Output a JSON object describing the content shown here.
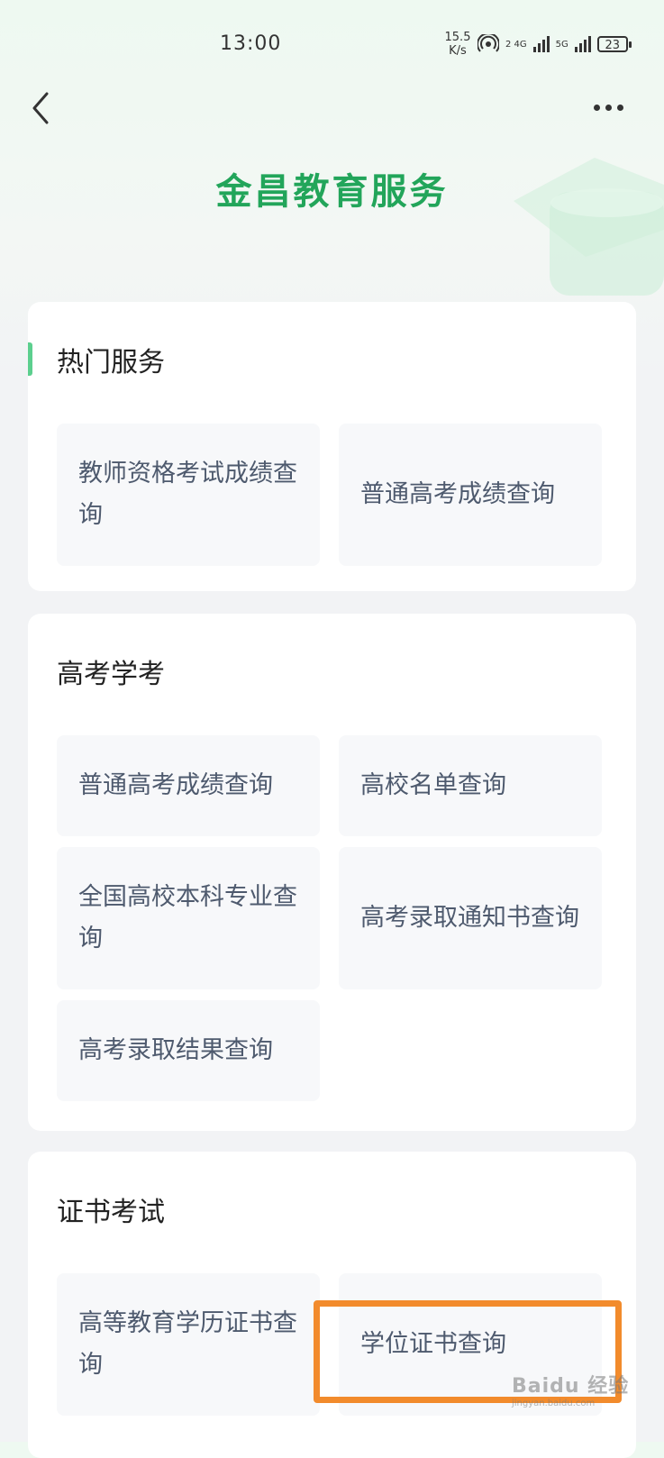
{
  "status_bar": {
    "time": "13:00",
    "net_speed_value": "15.5",
    "net_speed_unit": "K/s",
    "sim1_label": "2 4G",
    "sim2_label": "5G",
    "battery": "23"
  },
  "header": {
    "title": "金昌教育服务"
  },
  "sections": {
    "hot": {
      "title": "热门服务",
      "items": [
        "教师资格考试成绩查询",
        "普通高考成绩查询"
      ]
    },
    "gaokao": {
      "title": "高考学考",
      "items": [
        "普通高考成绩查询",
        "高校名单查询",
        "全国高校本科专业查询",
        "高考录取通知书查询",
        "高考录取结果查询"
      ]
    },
    "cert": {
      "title": "证书考试",
      "items": [
        "高等教育学历证书查询",
        "学位证书查询"
      ]
    }
  },
  "watermark": {
    "brand": "Baidu 经验",
    "url": "jingyan.baidu.com"
  },
  "colors": {
    "title_green": "#22a55a",
    "highlight_orange": "#f28b2c",
    "accent_green": "#5ccf8e"
  }
}
